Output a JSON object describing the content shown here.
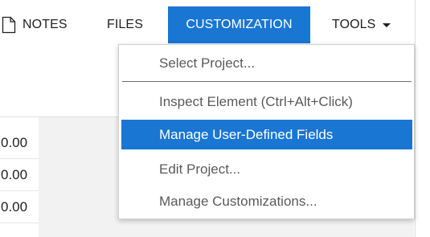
{
  "toolbar": {
    "notes_label": "NOTES",
    "files_label": "FILES",
    "customization_label": "CUSTOMIZATION",
    "tools_label": "TOOLS",
    "active_tab_color": "#1976d2"
  },
  "menu": {
    "items": [
      {
        "label": "Select Project..."
      },
      {
        "label": "Inspect Element (Ctrl+Alt+Click)"
      },
      {
        "label": "Manage User-Defined Fields"
      },
      {
        "label": "Edit Project..."
      },
      {
        "label": "Manage Customizations..."
      }
    ],
    "highlighted": "Manage User-Defined Fields"
  },
  "grid": {
    "values": [
      "0.00",
      "0.00",
      "0.00"
    ]
  },
  "icons": {
    "notes": "document-icon",
    "tools_dropdown": "caret-down-icon"
  }
}
